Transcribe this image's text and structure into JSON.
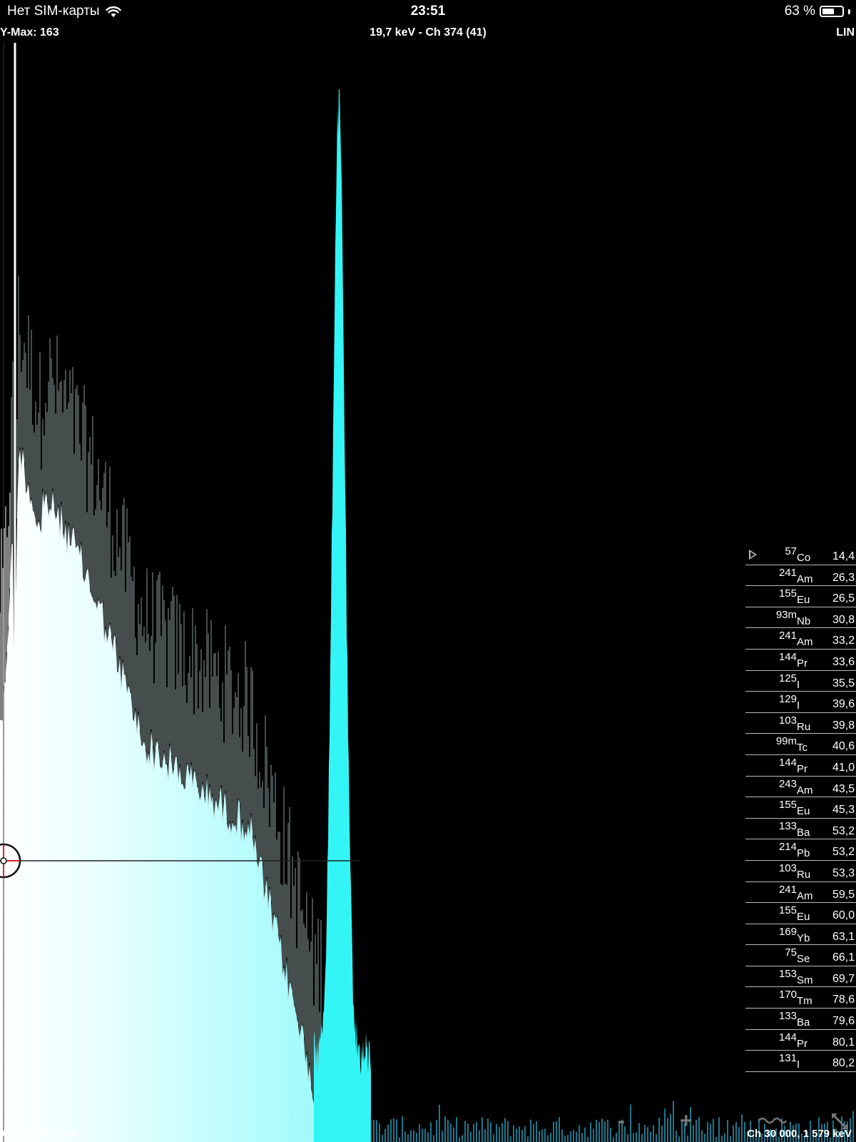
{
  "status_bar": {
    "carrier": "Нет SIM-карты",
    "time": "23:51",
    "battery": "63 %",
    "battery_level": 0.63
  },
  "info_bar": {
    "y_max": "Y-Max: 163",
    "cursor": "19,7 keV - Ch 374 (41)",
    "scale_mode": "LIN"
  },
  "axis": {
    "start": "Ch 250, 13 keV",
    "end": "Ch 30 000, 1 579 keV"
  },
  "controls": {
    "zoom_out": "-",
    "zoom_in": "+"
  },
  "isotopes": [
    {
      "mass": "57",
      "symbol": "Co",
      "energy": "14,4"
    },
    {
      "mass": "241",
      "symbol": "Am",
      "energy": "26,3"
    },
    {
      "mass": "155",
      "symbol": "Eu",
      "energy": "26,5"
    },
    {
      "mass": "93m",
      "symbol": "Nb",
      "energy": "30,8"
    },
    {
      "mass": "241",
      "symbol": "Am",
      "energy": "33,2"
    },
    {
      "mass": "144",
      "symbol": "Pr",
      "energy": "33,6"
    },
    {
      "mass": "125",
      "symbol": "I",
      "energy": "35,5"
    },
    {
      "mass": "129",
      "symbol": "I",
      "energy": "39,6"
    },
    {
      "mass": "103",
      "symbol": "Ru",
      "energy": "39,8"
    },
    {
      "mass": "99m",
      "symbol": "Tc",
      "energy": "40,6"
    },
    {
      "mass": "144",
      "symbol": "Pr",
      "energy": "41,0"
    },
    {
      "mass": "243",
      "symbol": "Am",
      "energy": "43,5"
    },
    {
      "mass": "155",
      "symbol": "Eu",
      "energy": "45,3"
    },
    {
      "mass": "133",
      "symbol": "Ba",
      "energy": "53,2"
    },
    {
      "mass": "214",
      "symbol": "Pb",
      "energy": "53,2"
    },
    {
      "mass": "103",
      "symbol": "Ru",
      "energy": "53,3"
    },
    {
      "mass": "241",
      "symbol": "Am",
      "energy": "59,5"
    },
    {
      "mass": "155",
      "symbol": "Eu",
      "energy": "60,0"
    },
    {
      "mass": "169",
      "symbol": "Yb",
      "energy": "63,1"
    },
    {
      "mass": "75",
      "symbol": "Se",
      "energy": "66,1"
    },
    {
      "mass": "153",
      "symbol": "Sm",
      "energy": "69,7"
    },
    {
      "mass": "170",
      "symbol": "Tm",
      "energy": "78,6"
    },
    {
      "mass": "133",
      "symbol": "Ba",
      "energy": "79,6"
    },
    {
      "mass": "144",
      "symbol": "Pr",
      "energy": "80,1"
    },
    {
      "mass": "131",
      "symbol": "I",
      "energy": "80,2"
    }
  ],
  "icons": {
    "wifi": "wifi-icon",
    "battery": "battery-icon",
    "play": "play-icon",
    "wave": "wave-icon",
    "resize": "resize-icon",
    "cursor": "crosshair-icon"
  },
  "colors": {
    "background": "#000000",
    "spectrum_fill": "#33f5f5",
    "spectrum_light": "#ffffff",
    "cursor_marker": "#e0202a"
  },
  "chart_data": {
    "type": "area",
    "title": "",
    "xlabel": "",
    "ylabel": "",
    "x_range": [
      "Ch 250, 13 keV",
      "Ch 30 000, 1 579 keV"
    ],
    "y_max": 163,
    "scale": "LIN",
    "cursor": {
      "energy_kev": 19.7,
      "channel": 374,
      "counts": 41
    },
    "peaks_kev": [
      14.4,
      59.5
    ],
    "grid": false
  }
}
